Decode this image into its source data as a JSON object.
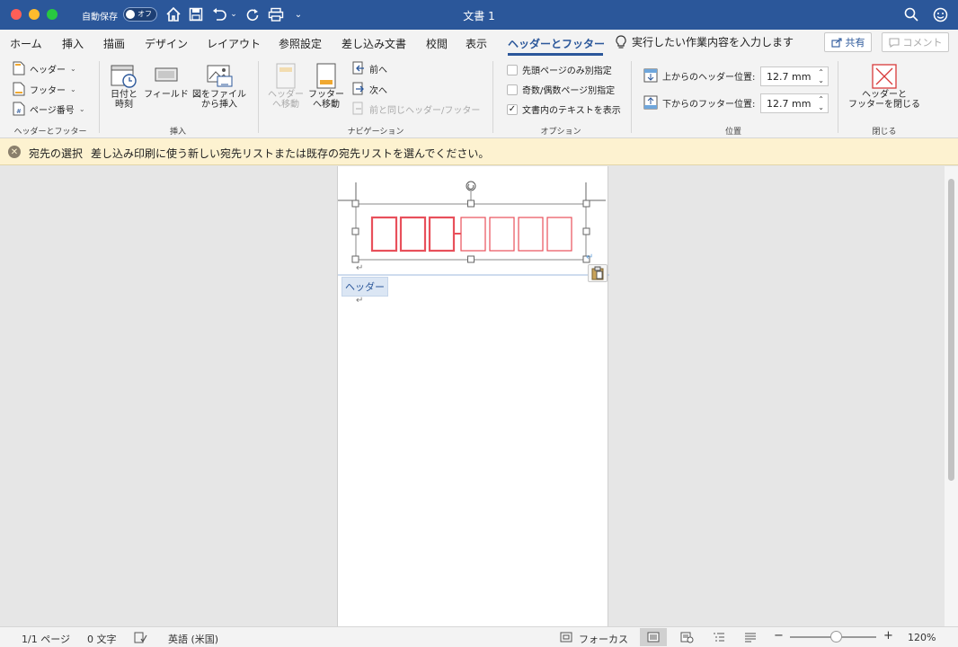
{
  "titlebar": {
    "autosave_label": "自動保存",
    "autosave_state": "オフ",
    "document_title": "文書 1",
    "icons": [
      "home-icon",
      "save-icon",
      "undo-icon",
      "redo-icon",
      "print-icon",
      "customize-icon",
      "search-icon",
      "smiley-icon"
    ]
  },
  "tabs": [
    {
      "label": "ホーム",
      "active": false
    },
    {
      "label": "挿入",
      "active": false
    },
    {
      "label": "描画",
      "active": false
    },
    {
      "label": "デザイン",
      "active": false
    },
    {
      "label": "レイアウト",
      "active": false
    },
    {
      "label": "参照設定",
      "active": false
    },
    {
      "label": "差し込み文書",
      "active": false
    },
    {
      "label": "校閲",
      "active": false
    },
    {
      "label": "表示",
      "active": false
    },
    {
      "label": "ヘッダーとフッター",
      "active": true
    }
  ],
  "tell_me": {
    "placeholder": "実行したい作業内容を入力します",
    "icon": "lightbulb-icon"
  },
  "share_label": "共有",
  "comment_label": "コメント",
  "ribbon": {
    "hf_group": {
      "label": "ヘッダーとフッター",
      "header_label": "ヘッダー",
      "footer_label": "フッター",
      "page_number_label": "ページ番号"
    },
    "insert_group": {
      "label": "挿入",
      "datetime_line1": "日付と",
      "datetime_line2": "時刻",
      "field_label": "フィールド",
      "picture_line1": "図をファイル",
      "picture_line2": "から挿入"
    },
    "nav_group": {
      "label": "ナビゲーション",
      "goto_header_line1": "ヘッダー",
      "goto_header_line2": "へ移動",
      "goto_footer_line1": "フッター",
      "goto_footer_line2": "へ移動",
      "prev_label": "前へ",
      "next_label": "次へ",
      "link_prev_label": "前と同じヘッダー/フッター"
    },
    "options_group": {
      "label": "オプション",
      "first_page_label": "先頭ページのみ別指定",
      "first_page_checked": false,
      "odd_even_label": "奇数/偶数ページ別指定",
      "odd_even_checked": false,
      "show_text_label": "文書内のテキストを表示",
      "show_text_checked": true
    },
    "position_group": {
      "label": "位置",
      "header_pos_label": "上からのヘッダー位置:",
      "header_pos_value": "12.7 mm",
      "footer_pos_label": "下からのフッター位置:",
      "footer_pos_value": "12.7 mm"
    },
    "close_group": {
      "label": "閉じる",
      "close_line1": "ヘッダーと",
      "close_line2": "フッターを閉じる"
    }
  },
  "message_bar": {
    "title": "宛先の選択",
    "text": "差し込み印刷に使う新しい宛先リストまたは既存の宛先リストを選んでください。"
  },
  "document": {
    "header_tag": "ヘッダー",
    "postal_boxes_count": 7,
    "box_color": "#e8505b"
  },
  "statusbar": {
    "page": "1/1 ページ",
    "words": "0 文字",
    "language": "英語 (米国)",
    "focus": "フォーカス",
    "zoom": "120%",
    "zoom_fraction": 0.5
  },
  "colors": {
    "accent": "#2b579a",
    "message_bg": "#fdf2d0"
  }
}
